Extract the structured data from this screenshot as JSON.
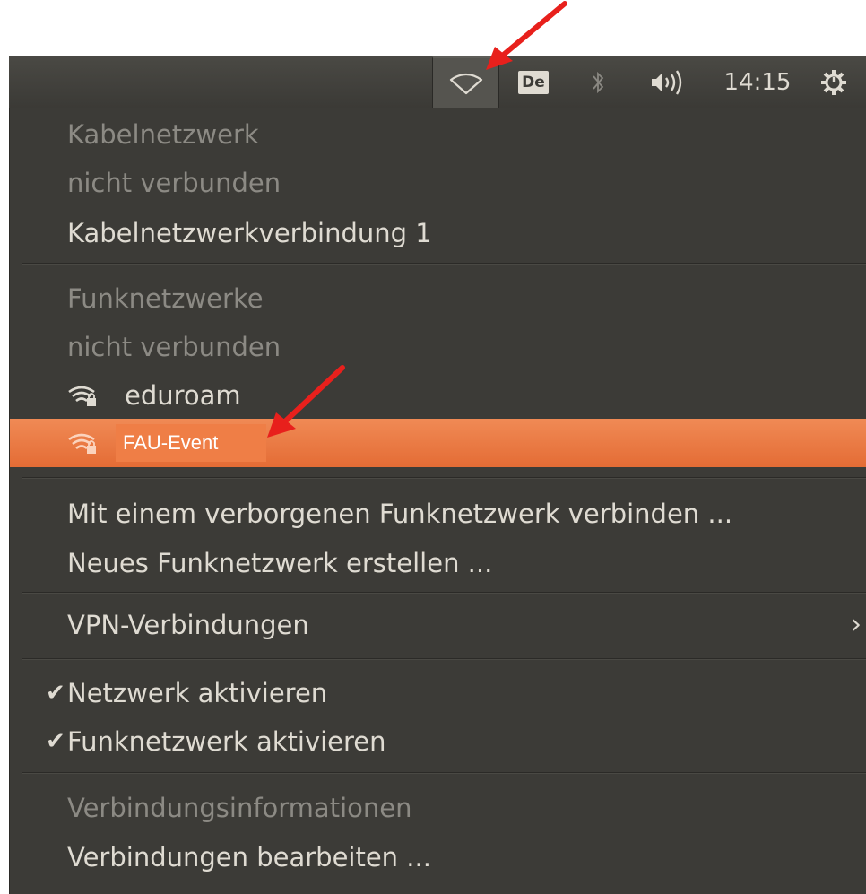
{
  "panel": {
    "keyboard_layout": "De",
    "clock": "14:15",
    "icons": [
      "network-icon",
      "keyboard-layout-icon",
      "bluetooth-icon",
      "volume-icon",
      "power-gear-icon"
    ]
  },
  "menu": {
    "wired_header": "Kabelnetzwerk",
    "wired_status": "nicht verbunden",
    "wired_connection": "Kabelnetzwerkverbindung 1",
    "wireless_header": "Funknetzwerke",
    "wireless_status": "nicht verbunden",
    "networks": [
      {
        "name": "eduroam",
        "icon": "wifi-secure-icon"
      },
      {
        "name": "FAU-Event",
        "icon": "wifi-secure-icon",
        "highlighted": true
      }
    ],
    "connect_hidden": "Mit einem verborgenen Funknetzwerk verbinden ...",
    "create_new": "Neues Funknetzwerk erstellen ...",
    "vpn": "VPN-Verbindungen",
    "enable_networking": "Netzwerk aktivieren",
    "enable_wifi": "Funknetzwerk aktivieren",
    "connection_info": "Verbindungsinformationen",
    "edit_connections": "Verbindungen bearbeiten ..."
  },
  "colors": {
    "menu_bg": "#3c3b37",
    "highlight": "#e9753f",
    "text": "#dfdbd2",
    "dim_text": "#8c8a84",
    "annotation_arrow": "#e8201c"
  }
}
